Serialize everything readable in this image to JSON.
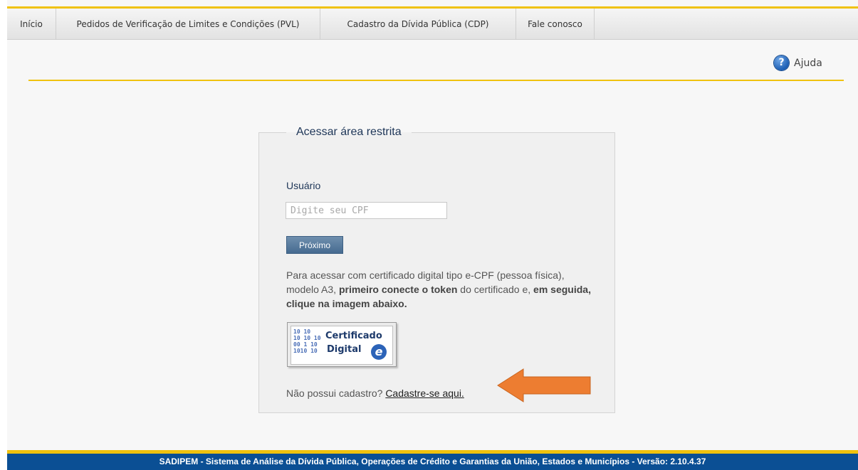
{
  "nav": {
    "items": [
      {
        "label": "Início"
      },
      {
        "label": "Pedidos de Verificação de Limites e Condições (PVL)"
      },
      {
        "label": "Cadastro da Dívida Pública (CDP)"
      },
      {
        "label": "Fale conosco"
      }
    ]
  },
  "help": {
    "icon": "question-circle-icon",
    "label": "Ajuda"
  },
  "login": {
    "title": "Acessar área restrita",
    "user_label": "Usuário",
    "cpf_value": "",
    "cpf_placeholder": "Digite seu CPF",
    "next_label": "Próximo",
    "info_part1": "Para acessar com certificado digital tipo e-CPF (pessoa física), modelo A3, ",
    "info_bold1": "primeiro conecte o token",
    "info_part2": " do certificado e, ",
    "info_bold2": "em seguida, clique na imagem abaixo.",
    "cert_title_1": "Certificado",
    "cert_title_2": "Digital",
    "cert_e": "e",
    "cert_bits": "10 10  \n10 10 10\n00 1 10\n1010 10",
    "signup_text": "Não possui cadastro?",
    "signup_link": "Cadastre-se aqui."
  },
  "annotation": {
    "icon": "arrow-left-icon",
    "color": "#ed7d31"
  },
  "colors": {
    "accent": "#f0c20e",
    "footer_bg": "#0b4f94",
    "button": "#466b90"
  },
  "footer": {
    "text": "SADIPEM - Sistema de Análise da Dívida Pública, Operações de Crédito e Garantias da União, Estados e Municípios - Versão: 2.10.4.37"
  }
}
